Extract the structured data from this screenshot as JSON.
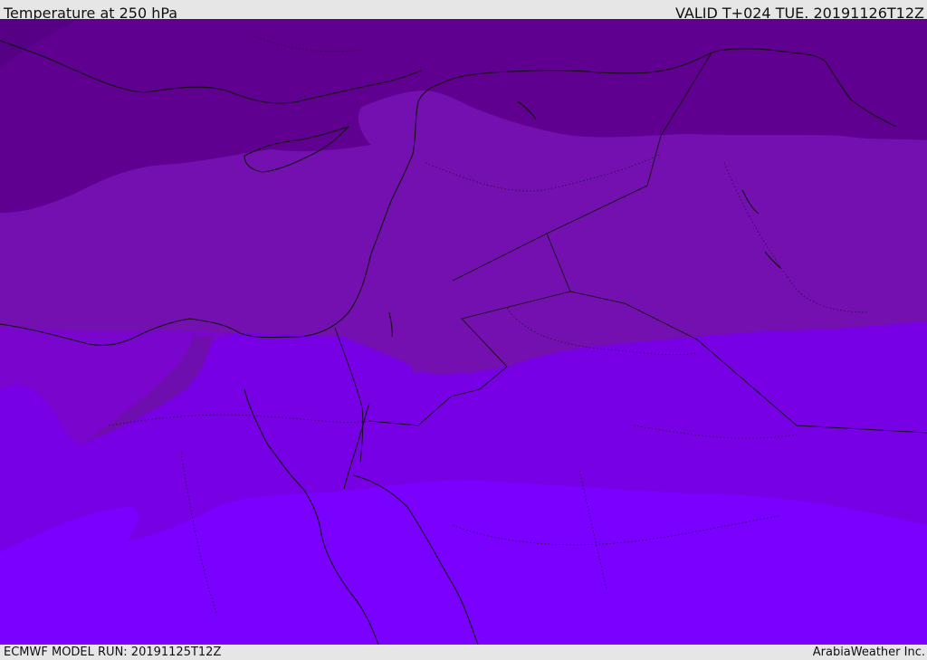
{
  "header": {
    "title": "Temperature at 250 hPa",
    "valid": "VALID T+024 TUE. 20191126T12Z"
  },
  "footer": {
    "model_run": "ECMWF MODEL RUN: 20191125T12Z",
    "credit": "ArabiaWeather Inc."
  },
  "map": {
    "colors": {
      "band_darkest": "#550085",
      "band_dark": "#5f0090",
      "band_mid": "#7410b0",
      "band_mid2": "#7a05cd",
      "band_light": "#7700e5",
      "band_lightest": "#7a00ff",
      "coastline": "#111111",
      "border": "#2a0a40"
    },
    "layers": [
      "temperature-shading",
      "coastlines",
      "country-borders"
    ]
  }
}
